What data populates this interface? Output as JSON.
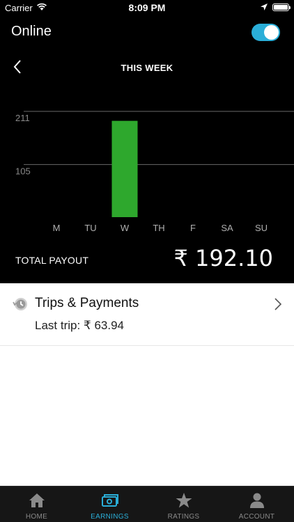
{
  "status_bar": {
    "carrier": "Carrier",
    "time": "8:09 PM"
  },
  "header": {
    "title": "Online",
    "toggle_on": true
  },
  "week_nav": {
    "title": "THIS WEEK"
  },
  "chart_data": {
    "type": "bar",
    "categories": [
      "M",
      "TU",
      "W",
      "TH",
      "F",
      "SA",
      "SU"
    ],
    "values": [
      0,
      0,
      192.1,
      0,
      0,
      0,
      0
    ],
    "yticks": [
      "211",
      "105"
    ],
    "ytick_values": [
      211,
      105
    ],
    "ylim": [
      0,
      211
    ],
    "bar_color": "#2ea82d",
    "grid": true
  },
  "payout": {
    "label": "TOTAL PAYOUT",
    "value": "₹ 192.10"
  },
  "trips": {
    "title": "Trips & Payments",
    "last_trip": "Last trip: ₹ 63.94"
  },
  "tabbar": {
    "tabs": [
      {
        "label": "HOME",
        "icon": "home-icon"
      },
      {
        "label": "EARNINGS",
        "icon": "earnings-icon",
        "active": true
      },
      {
        "label": "RATINGS",
        "icon": "star-icon"
      },
      {
        "label": "ACCOUNT",
        "icon": "account-icon"
      }
    ]
  },
  "colors": {
    "accent": "#2aaed8",
    "bar": "#2ea82d",
    "background_dark": "#000000"
  }
}
